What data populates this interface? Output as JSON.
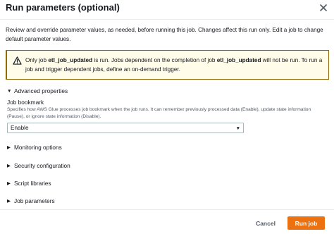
{
  "modal": {
    "title": "Run parameters (optional)",
    "close_icon": "close-icon"
  },
  "description": "Review and override parameter values, as needed, before running this job. Changes affect this run only. Edit a job to change default parameter values.",
  "alert": {
    "icon": "warning-icon",
    "text_before": "Only job ",
    "job_name_1": "etl_job_updated",
    "text_middle": " is run. Jobs dependent on the completion of job ",
    "job_name_2": "etl_job_updated",
    "text_after": " will not be run. To run a job and trigger dependent jobs, define an on-demand trigger."
  },
  "advanced_properties": {
    "label": "Advanced properties",
    "expanded": true,
    "job_bookmark": {
      "label": "Job bookmark",
      "description": "Specifies how AWS Glue processes job bookmark when the job runs. It can remember previously processed data (Enable), update state information (Pause), or ignore state information (Disable).",
      "selected": "Enable"
    }
  },
  "sections": [
    {
      "label": "Monitoring options",
      "expanded": false
    },
    {
      "label": "Security configuration",
      "expanded": false
    },
    {
      "label": "Script libraries",
      "expanded": false
    },
    {
      "label": "Job parameters",
      "expanded": false
    }
  ],
  "footer": {
    "cancel_label": "Cancel",
    "run_label": "Run job"
  },
  "colors": {
    "primary_button": "#ec7211",
    "alert_background": "#fffce9",
    "alert_border": "#906806"
  }
}
